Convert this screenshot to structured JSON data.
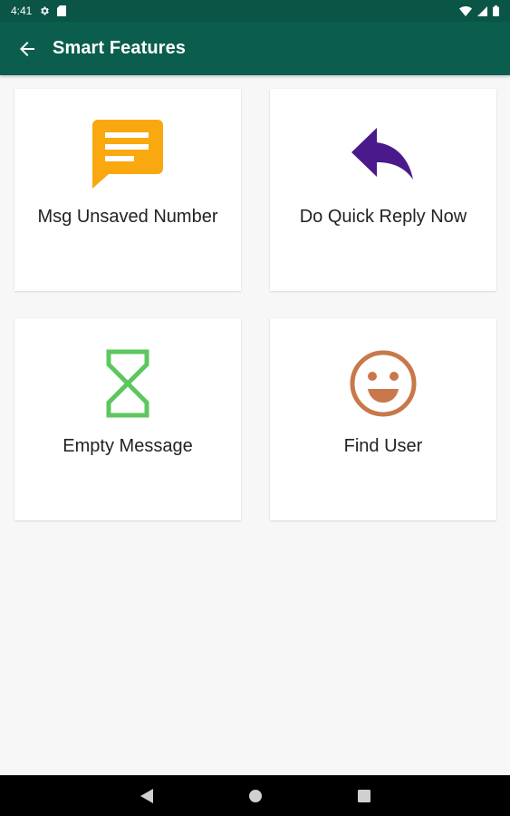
{
  "status_bar": {
    "time": "4:41",
    "icons": [
      "settings-icon",
      "sd-card-icon",
      "wifi-icon",
      "signal-icon",
      "battery-icon"
    ]
  },
  "app_bar": {
    "title": "Smart Features",
    "background": "#0b5e4e",
    "back_icon": "arrow-back-icon"
  },
  "features": [
    {
      "label": "Msg Unsaved Number",
      "icon": "message-icon",
      "color": "#f9a80f"
    },
    {
      "label": "Do Quick Reply Now",
      "icon": "reply-arrow-icon",
      "color": "#4a1a8c"
    },
    {
      "label": "Empty Message",
      "icon": "hourglass-icon",
      "color": "#5cc75f"
    },
    {
      "label": "Find User",
      "icon": "smiley-face-icon",
      "color": "#c8784a"
    }
  ],
  "nav_bar": {
    "buttons": [
      "back-triangle-icon",
      "home-circle-icon",
      "recents-square-icon"
    ]
  }
}
